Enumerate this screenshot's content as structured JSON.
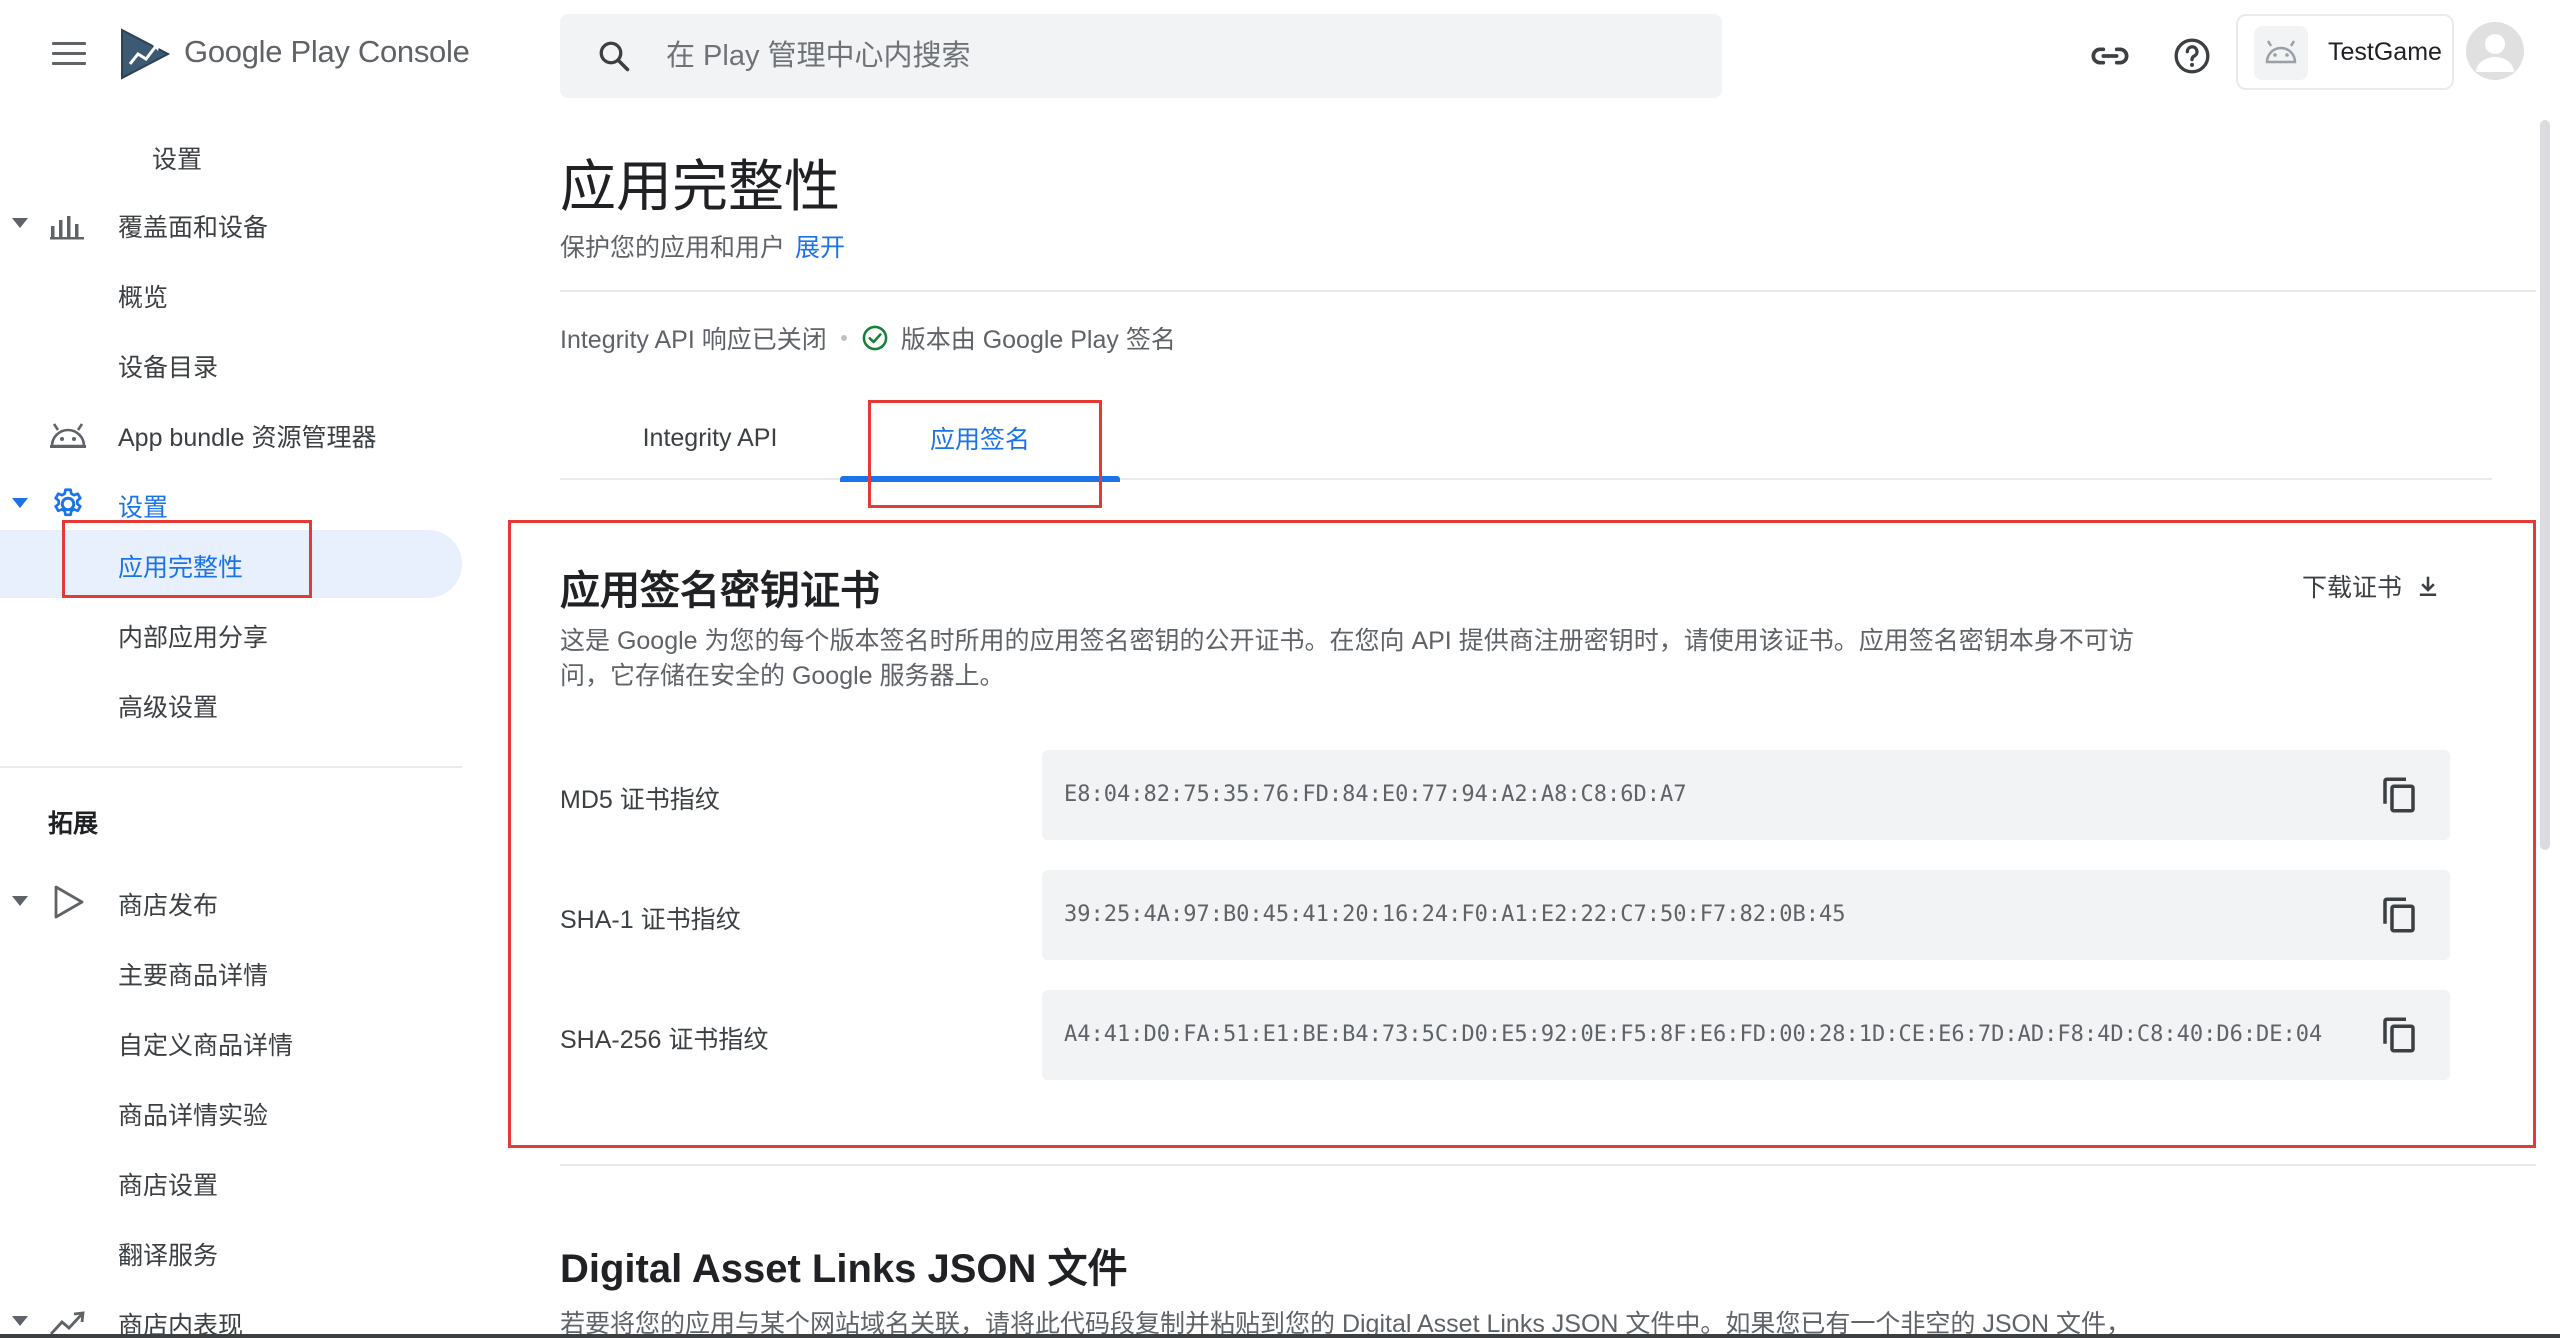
{
  "header": {
    "brand": "Google Play Console",
    "search_placeholder": "在 Play 管理中心内搜索",
    "app_name": "TestGame",
    "icons": [
      "menu-icon",
      "play-console-logo",
      "search-icon",
      "link-icon",
      "help-icon",
      "android-icon",
      "account-icon"
    ]
  },
  "sidebar": {
    "items": [
      {
        "label": "设置",
        "level": 2
      },
      {
        "label": "覆盖面和设备",
        "level": 1,
        "icon": "bar-chart-icon"
      },
      {
        "label": "概览",
        "level": 2
      },
      {
        "label": "设备目录",
        "level": 2
      },
      {
        "label": "App bundle 资源管理器",
        "level": 1,
        "icon": "android-icon"
      },
      {
        "label": "设置",
        "level": 1,
        "icon": "gear-icon"
      },
      {
        "label": "应用完整性",
        "level": 2,
        "active": true
      },
      {
        "label": "内部应用分享",
        "level": 2
      },
      {
        "label": "高级设置",
        "level": 2
      }
    ],
    "section_title": "拓展",
    "items2": [
      {
        "label": "商店发布",
        "level": 1,
        "icon": "play-icon"
      },
      {
        "label": "主要商品详情",
        "level": 2
      },
      {
        "label": "自定义商品详情",
        "level": 2
      },
      {
        "label": "商品详情实验",
        "level": 2
      },
      {
        "label": "商店设置",
        "level": 2
      },
      {
        "label": "翻译服务",
        "level": 2
      },
      {
        "label": "商店内表现",
        "level": 1,
        "icon": "trend-icon"
      }
    ]
  },
  "main": {
    "title": "应用完整性",
    "subtitle": "保护您的应用和用户",
    "expand_link": "展开",
    "status_api": "Integrity API 响应已关闭",
    "status_signing": "版本由 Google Play 签名",
    "tabs": [
      {
        "label": "Integrity API",
        "selected": false
      },
      {
        "label": "应用签名",
        "selected": true
      }
    ],
    "card": {
      "title": "应用签名密钥证书",
      "download_label": "下载证书",
      "description": "这是 Google 为您的每个版本签名时所用的应用签名密钥的公开证书。在您向 API 提供商注册密钥时，请使用该证书。应用签名密钥本身不可访问，它存储在安全的 Google 服务器上。",
      "fingerprints": [
        {
          "label": "MD5 证书指纹",
          "value": "E8:04:82:75:35:76:FD:84:E0:77:94:A2:A8:C8:6D:A7"
        },
        {
          "label": "SHA-1 证书指纹",
          "value": "39:25:4A:97:B0:45:41:20:16:24:F0:A1:E2:22:C7:50:F7:82:0B:45"
        },
        {
          "label": "SHA-256 证书指纹",
          "value": "A4:41:D0:FA:51:E1:BE:B4:73:5C:D0:E5:92:0E:F5:8F:E6:FD:00:28:1D:CE:E6:7D:AD:F8:4D:C8:40:D6:DE:04"
        }
      ]
    },
    "section2": {
      "title": "Digital Asset Links JSON 文件",
      "description": "若要将您的应用与某个网站域名关联，请将此代码段复制并粘贴到您的 Digital Asset Links JSON 文件中。如果您已有一个非空的 JSON 文件，"
    }
  },
  "colors": {
    "accent": "#1a73e8",
    "highlight": "#e53935",
    "success": "#188038"
  }
}
